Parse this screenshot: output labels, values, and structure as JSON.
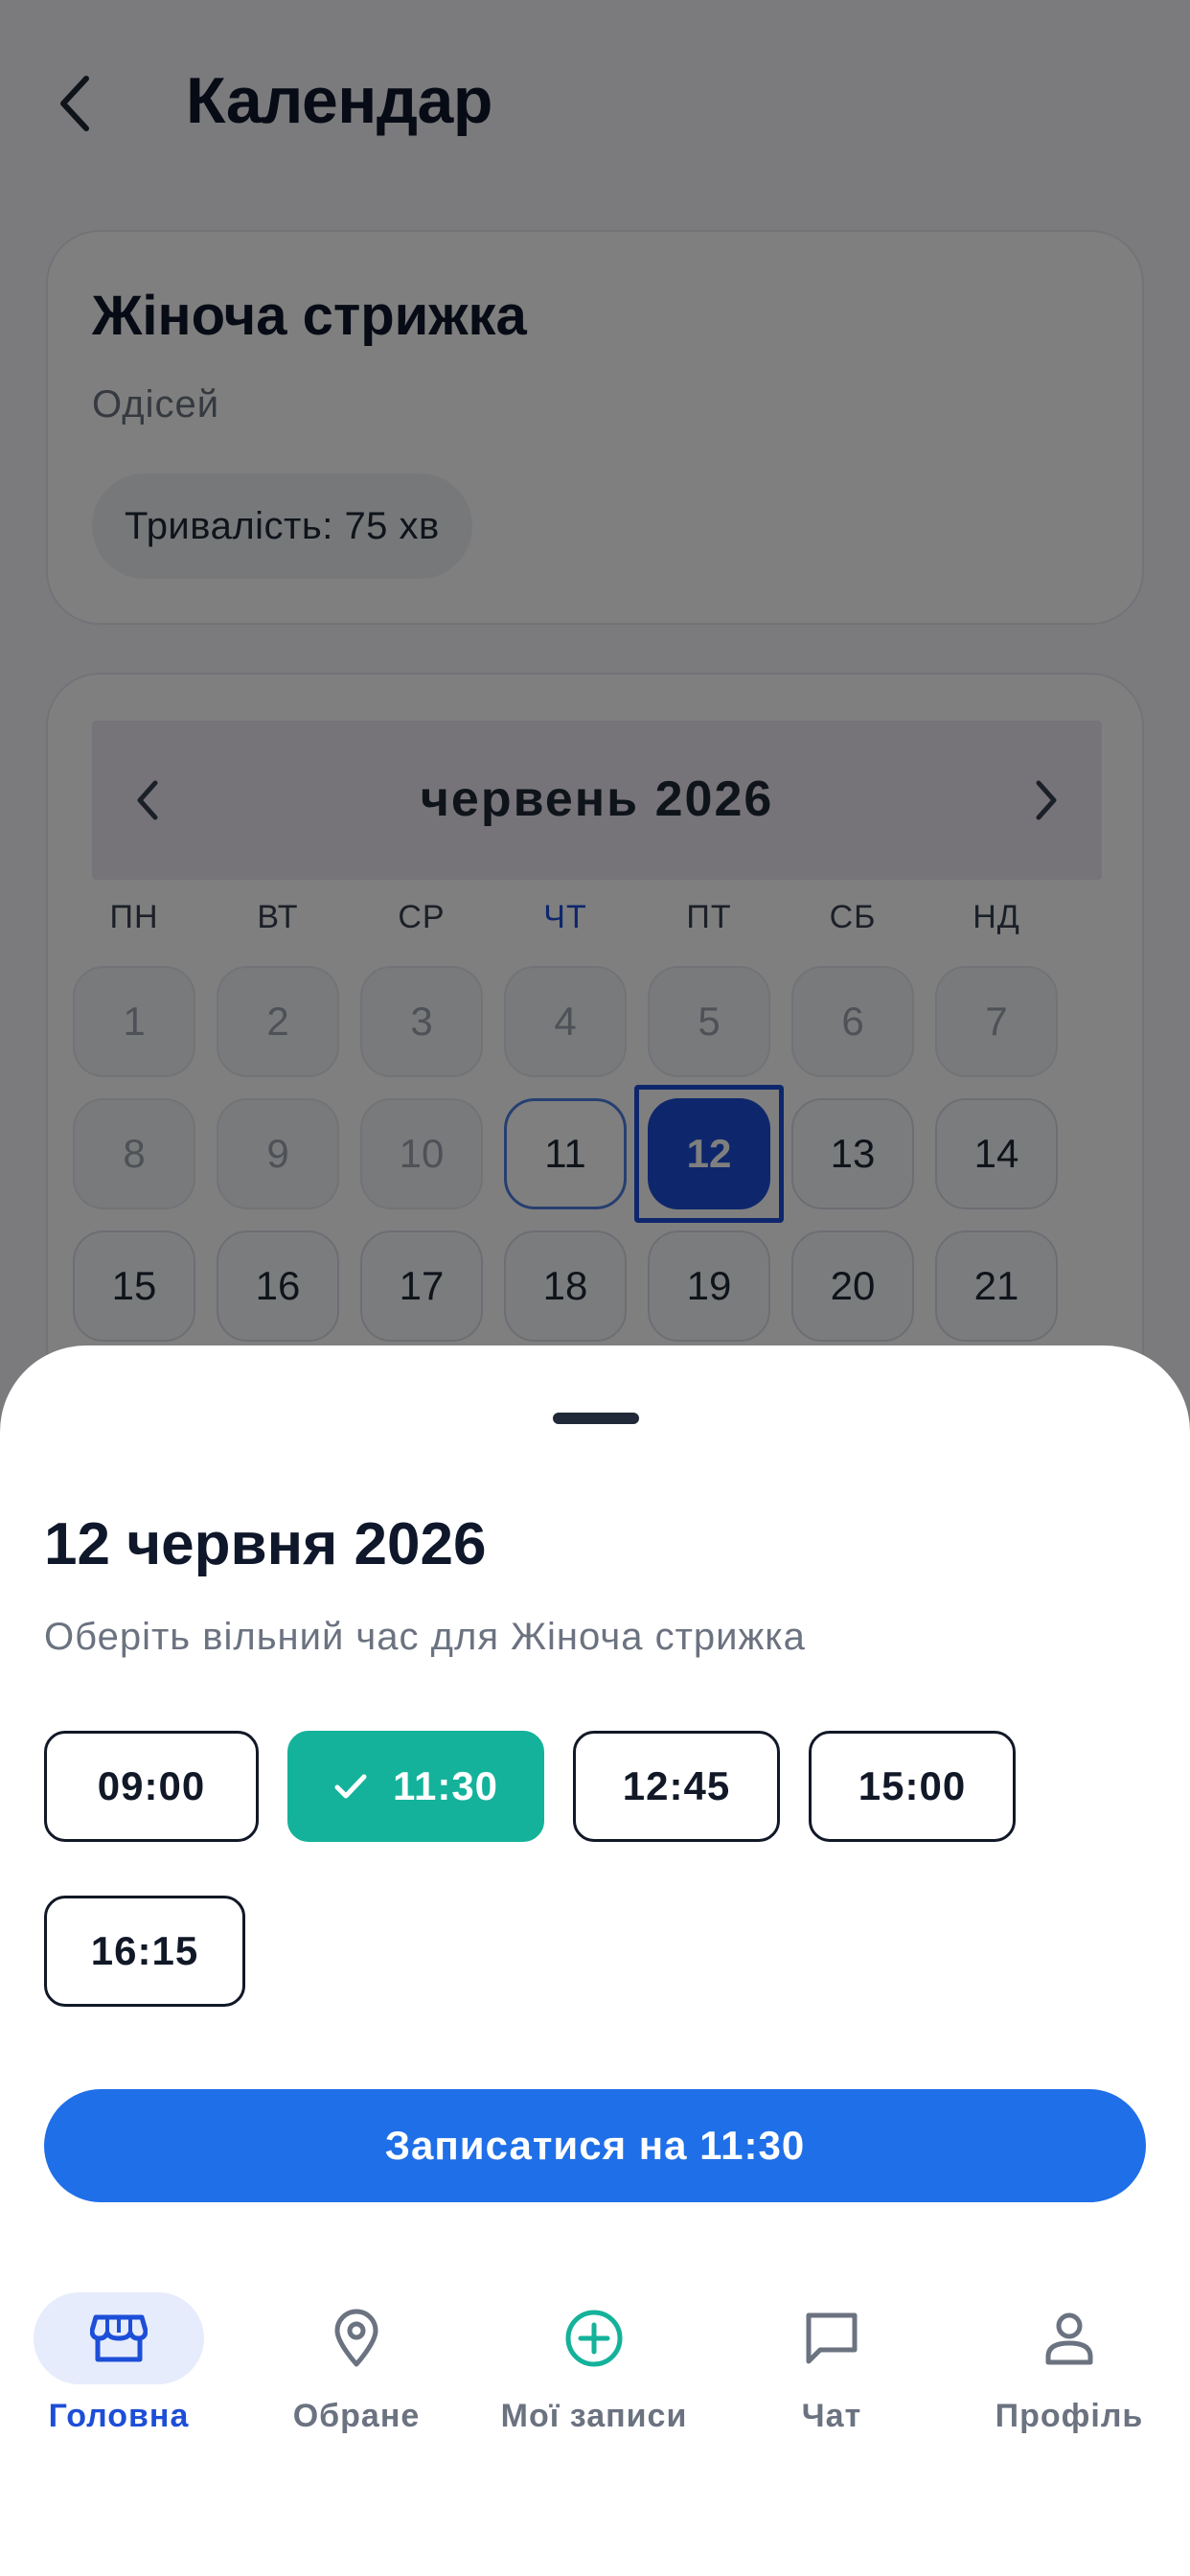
{
  "header": {
    "title": "Календар",
    "back_icon": "chevron-left-icon"
  },
  "service": {
    "name": "Жіноча стрижка",
    "salon": "Одісей",
    "duration": "Тривалість: 75 хв"
  },
  "calendar": {
    "month_title": "червень 2026",
    "weekdays": [
      "ПН",
      "ВТ",
      "СР",
      "ЧТ",
      "ПТ",
      "СБ",
      "НД"
    ],
    "today_weekday_index": 3,
    "days": [
      "1",
      "2",
      "3",
      "4",
      "5",
      "6",
      "7",
      "8",
      "9",
      "10",
      "11",
      "12",
      "13",
      "14",
      "15",
      "16",
      "17",
      "18",
      "19",
      "20",
      "21"
    ],
    "past_days": [
      "1",
      "2",
      "3",
      "4",
      "5",
      "6",
      "7",
      "8",
      "9",
      "10"
    ],
    "today": "11",
    "selected": "12",
    "accent_color": "#1d4ed8"
  },
  "sheet": {
    "title": "12 червня 2026",
    "subtitle": "Оберіть вільний час для Жіноча стрижка",
    "slots": [
      {
        "time": "09:00",
        "selected": false
      },
      {
        "time": "11:30",
        "selected": true
      },
      {
        "time": "12:45",
        "selected": false
      },
      {
        "time": "15:00",
        "selected": false
      },
      {
        "time": "16:15",
        "selected": false
      }
    ],
    "book_label": "Записатися на 11:30",
    "selected_color": "#14b29a",
    "button_color": "#1f6fe8"
  },
  "nav": {
    "items": [
      {
        "label": "Головна",
        "icon": "store-icon",
        "active": true
      },
      {
        "label": "Обране",
        "icon": "location-pin-icon",
        "active": false
      },
      {
        "label": "Мої записи",
        "icon": "plus-circle-icon",
        "active": false
      },
      {
        "label": "Чат",
        "icon": "chat-icon",
        "active": false
      },
      {
        "label": "Профіль",
        "icon": "user-icon",
        "active": false
      }
    ]
  }
}
